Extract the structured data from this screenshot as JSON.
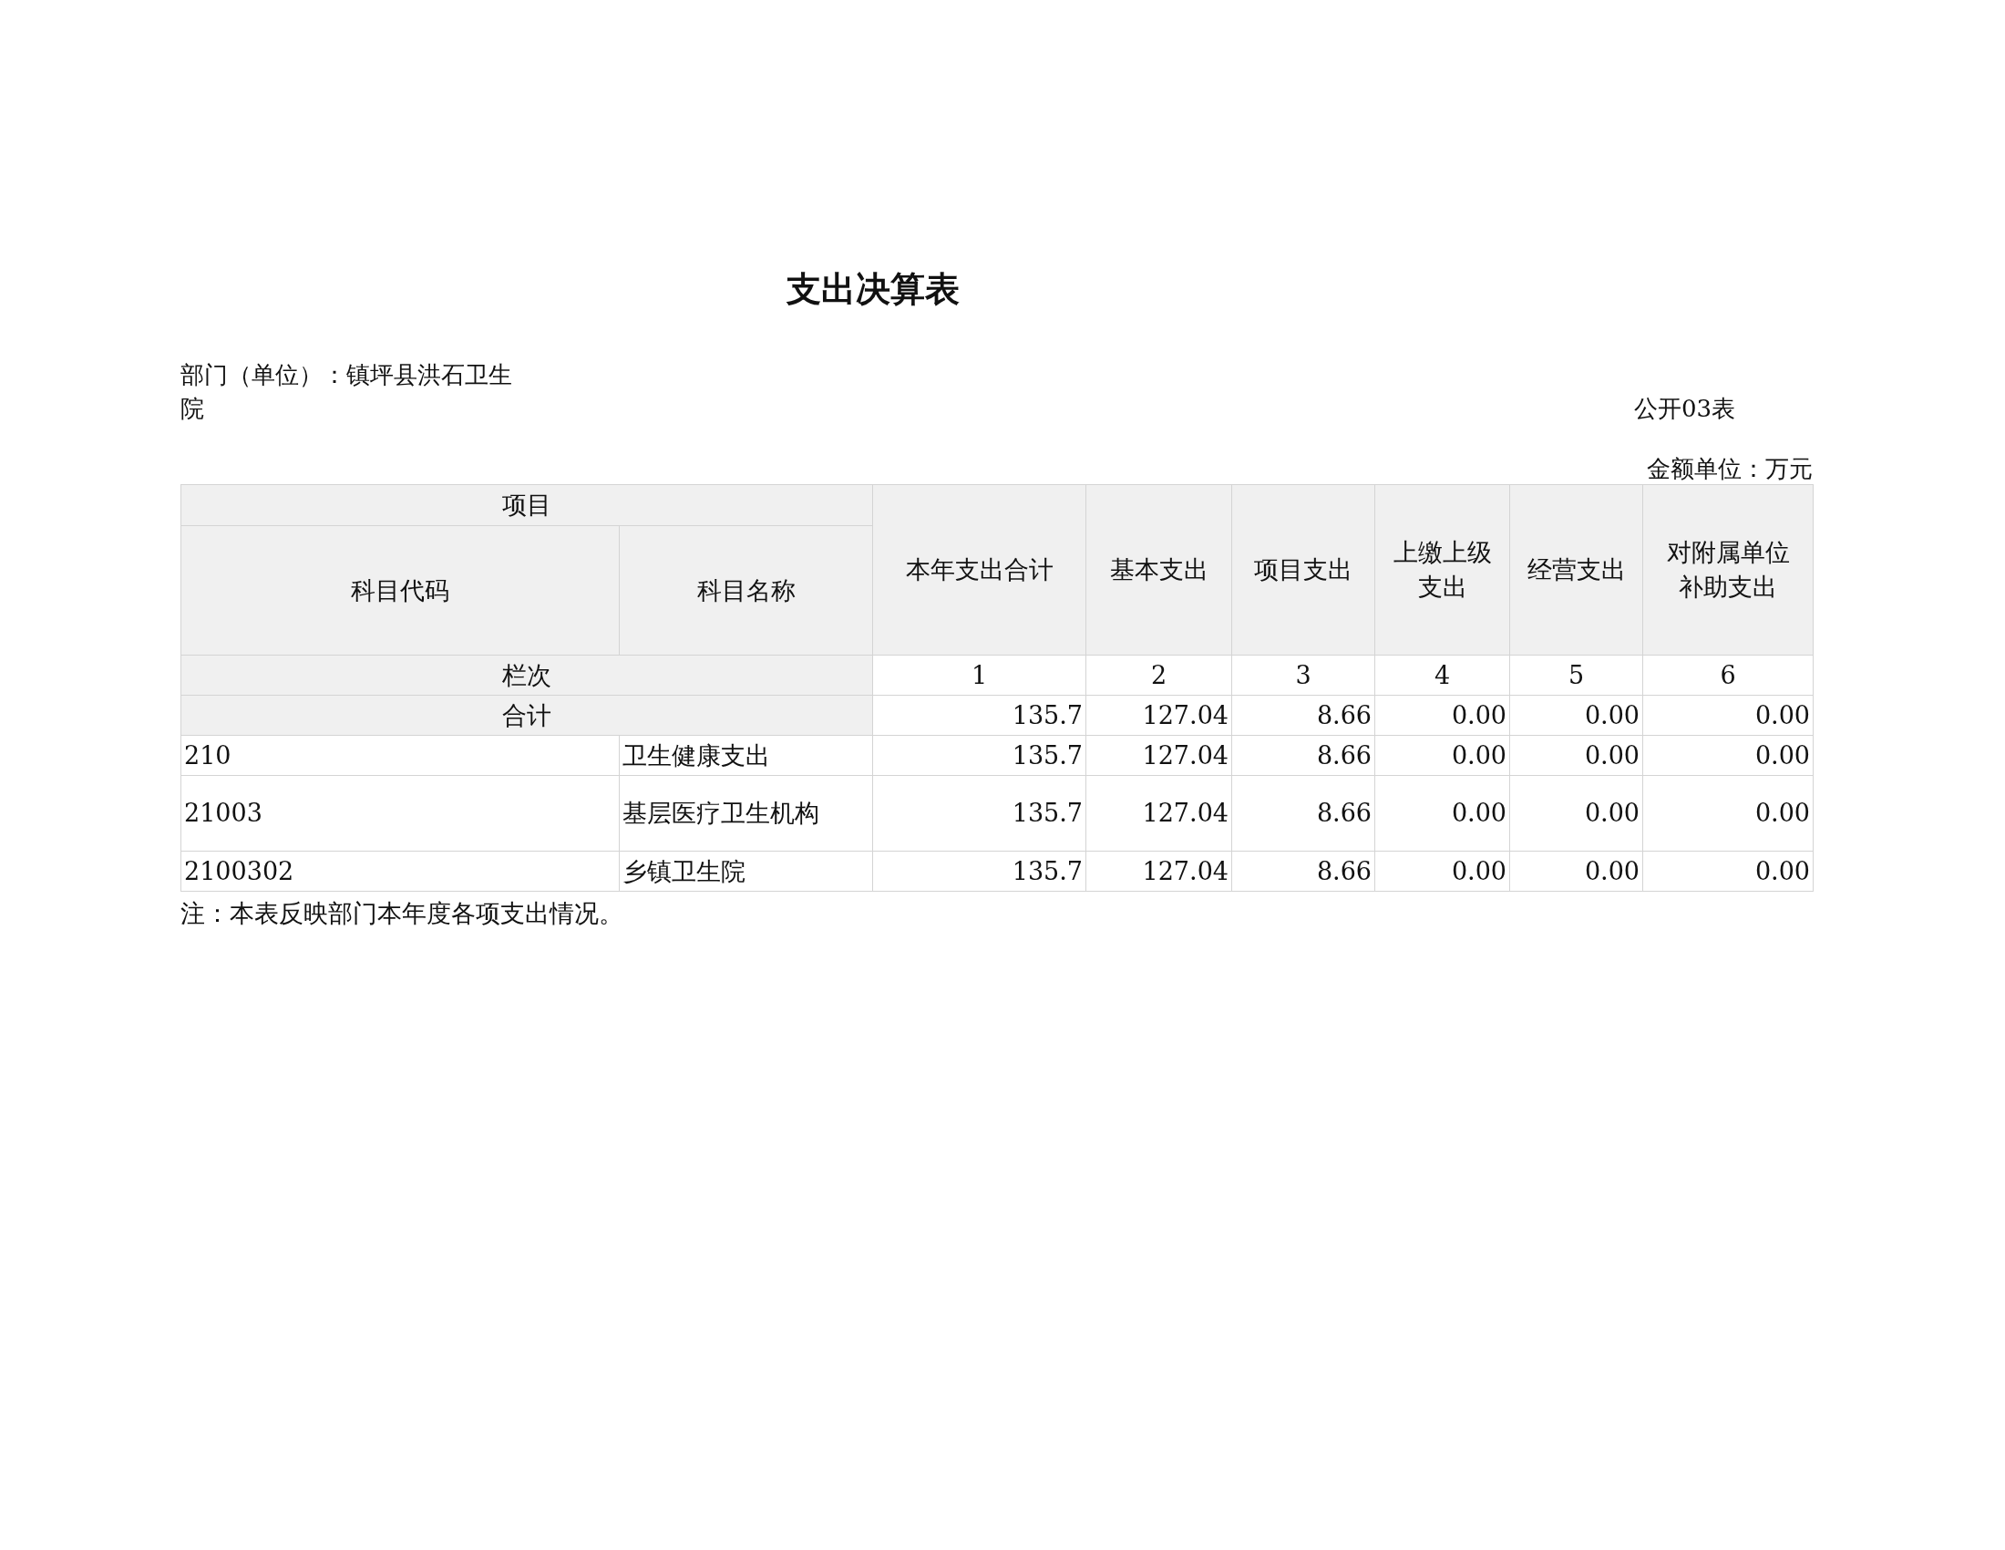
{
  "title": "支出决算表",
  "department": "部门（单位）：镇坪县洪石卫生院",
  "table_no": "公开03表",
  "unit": "金额单位：万元",
  "table": {
    "group_header": "项目",
    "sub_headers": [
      "科目代码",
      "科目名称"
    ],
    "columns": [
      "本年支出合计",
      "基本支出",
      "项目支出",
      "上缴上级支出",
      "经营支出",
      "对附属单位补助支出"
    ],
    "index_row": {
      "label": "栏次",
      "values": [
        "1",
        "2",
        "3",
        "4",
        "5",
        "6"
      ]
    },
    "total_row": {
      "label": "合计",
      "values": [
        "135.7",
        "127.04",
        "8.66",
        "0.00",
        "0.00",
        "0.00"
      ]
    },
    "rows": [
      {
        "code": "210",
        "name": "卫生健康支出",
        "values": [
          "135.7",
          "127.04",
          "8.66",
          "0.00",
          "0.00",
          "0.00"
        ],
        "tall": false
      },
      {
        "code": "21003",
        "name": "基层医疗卫生机构",
        "values": [
          "135.7",
          "127.04",
          "8.66",
          "0.00",
          "0.00",
          "0.00"
        ],
        "tall": true
      },
      {
        "code": "2100302",
        "name": "乡镇卫生院",
        "values": [
          "135.7",
          "127.04",
          "8.66",
          "0.00",
          "0.00",
          "0.00"
        ],
        "tall": false
      }
    ]
  },
  "note": "注：本表反映部门本年度各项支出情况。"
}
